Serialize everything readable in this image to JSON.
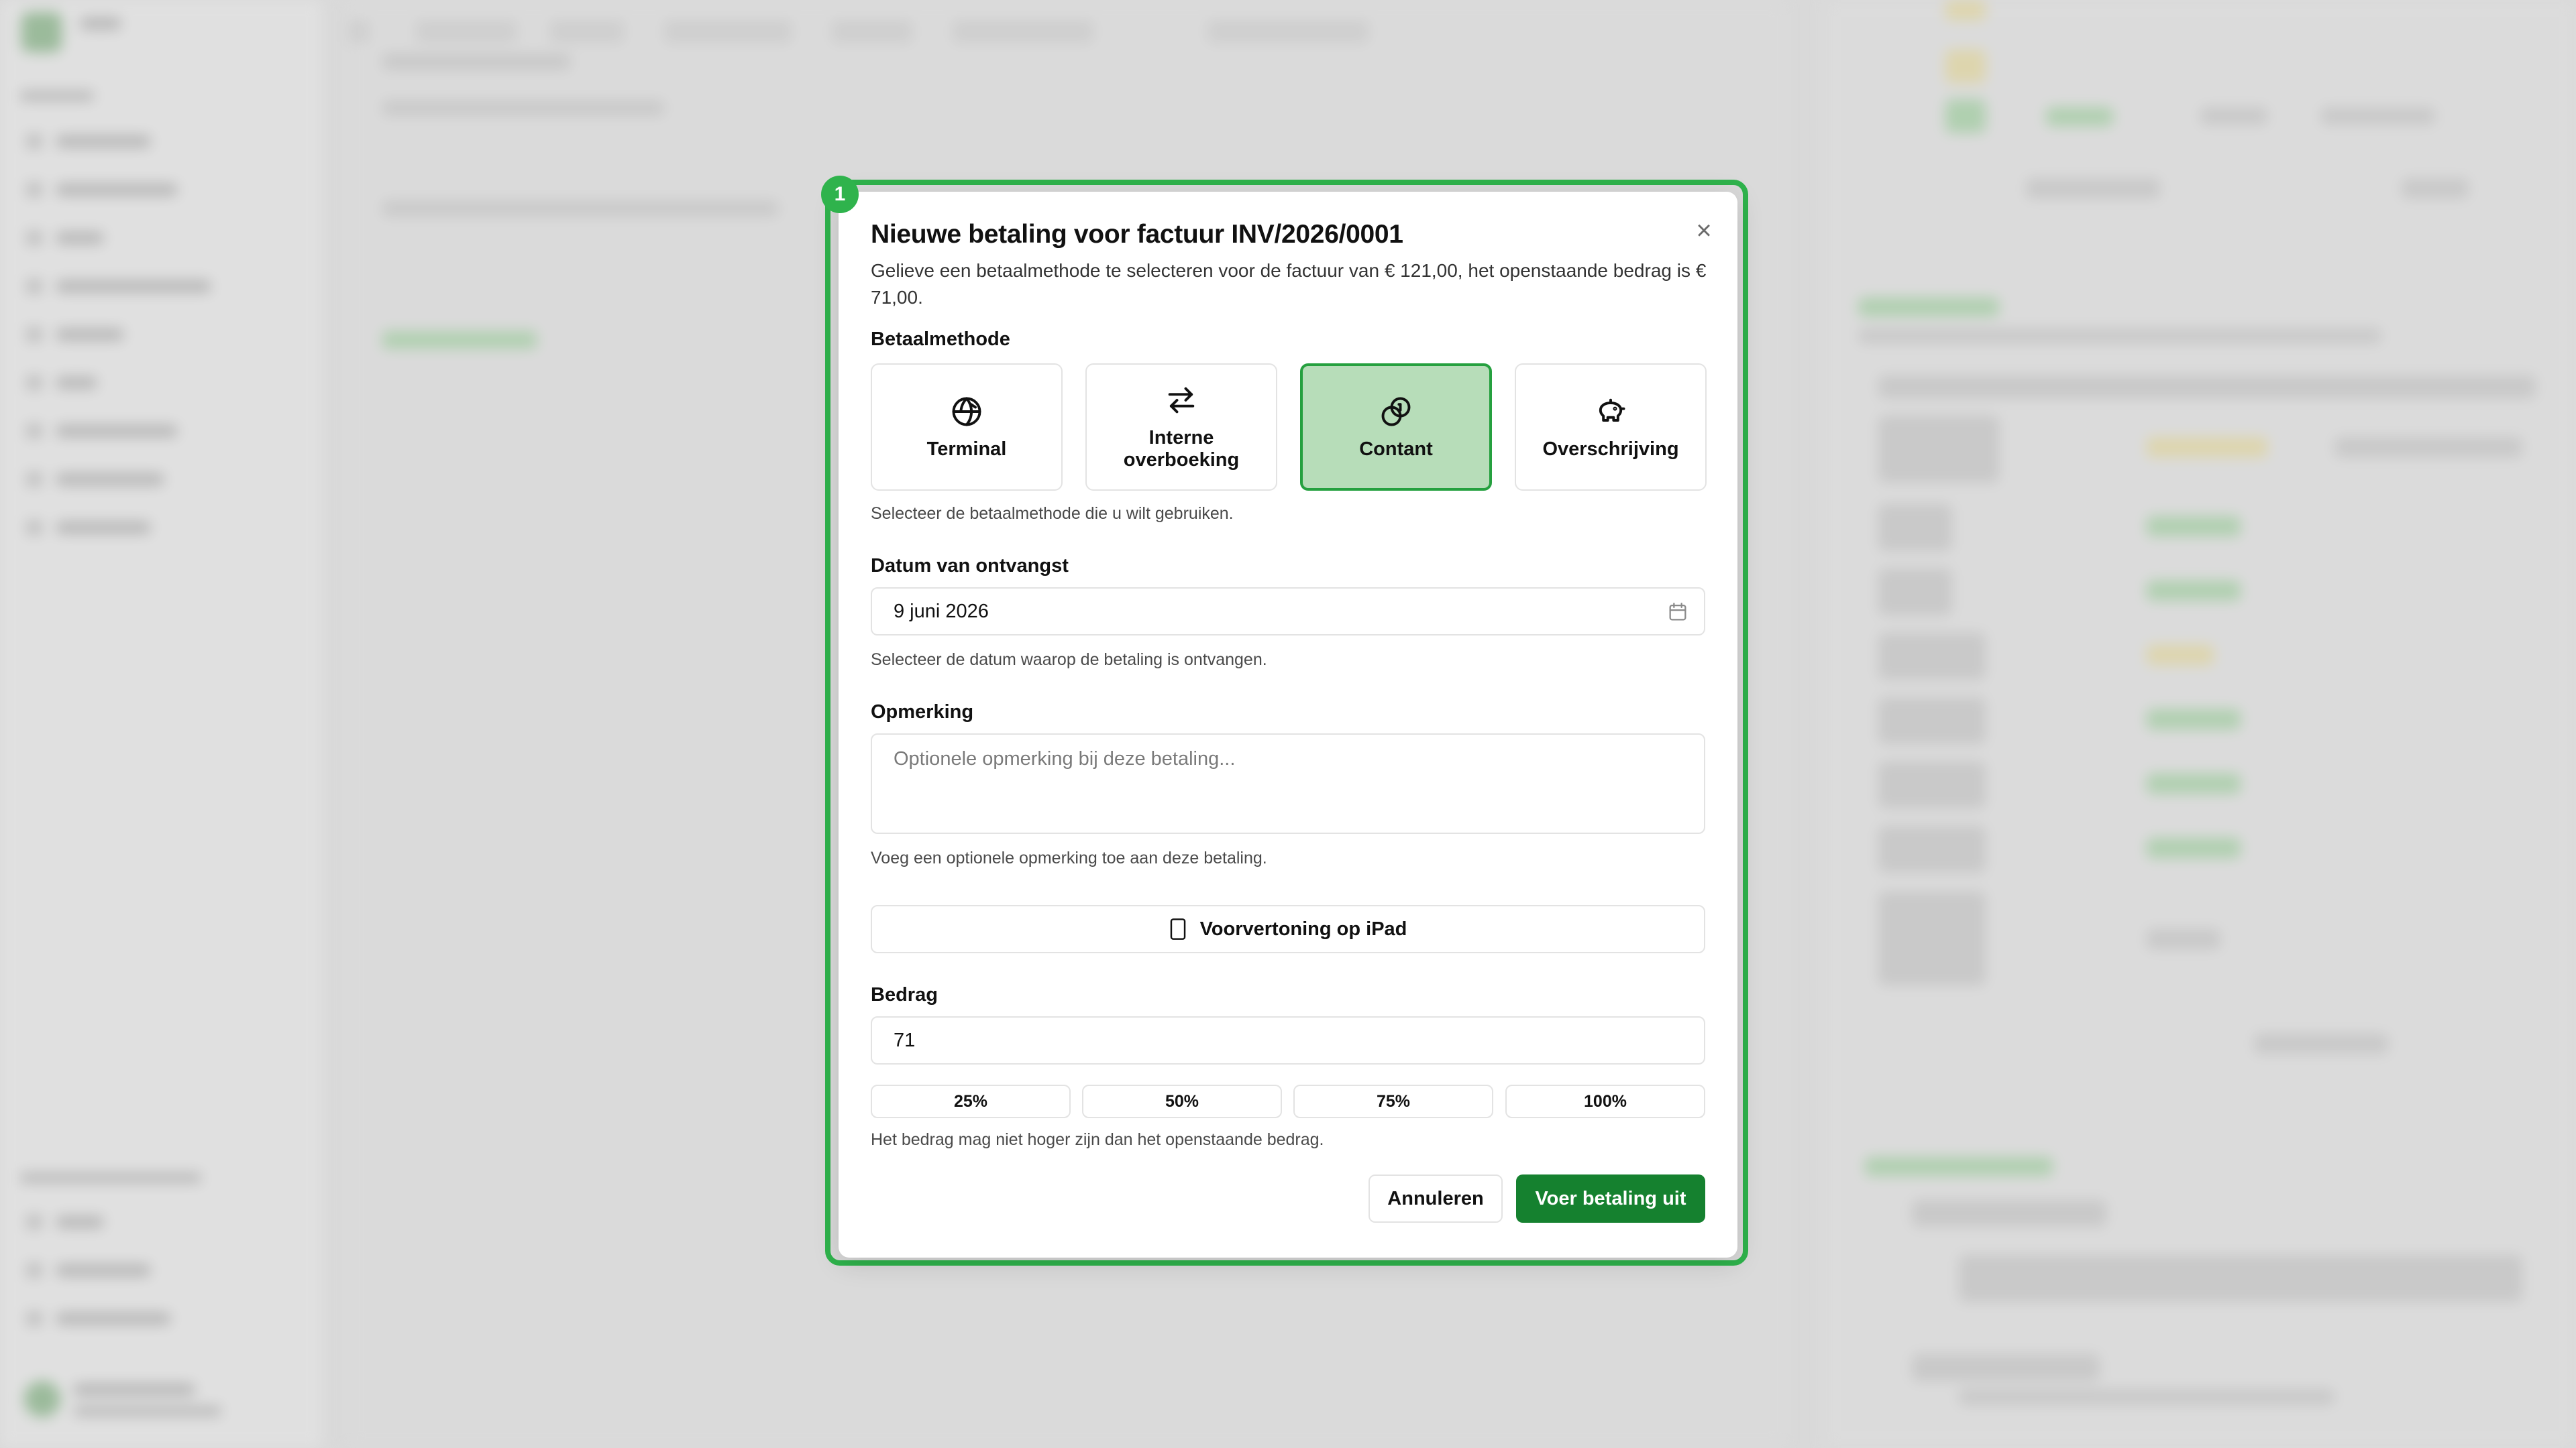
{
  "dialog": {
    "title": "Nieuwe betaling voor factuur INV/2026/0001",
    "description": "Gelieve een betaalmethode te selecteren voor de factuur van € 121,00, het openstaande bedrag is € 71,00.",
    "highlight_number": "1",
    "close_icon": "close-icon"
  },
  "payment_method": {
    "label": "Betaalmethode",
    "help": "Selecteer de betaalmethode die u wilt gebruiken.",
    "selected": "Contant",
    "options": [
      {
        "label": "Terminal",
        "icon": "globe-icon"
      },
      {
        "label": "Interne overboeking",
        "icon": "arrows-swap-icon"
      },
      {
        "label": "Contant",
        "icon": "coins-icon"
      },
      {
        "label": "Overschrijving",
        "icon": "piggy-bank-icon"
      }
    ]
  },
  "received_date": {
    "label": "Datum van ontvangst",
    "value": "9 juni 2026",
    "help": "Selecteer de datum waarop de betaling is ontvangen.",
    "icon": "calendar-icon"
  },
  "remark": {
    "label": "Opmerking",
    "placeholder": "Optionele opmerking bij deze betaling...",
    "help": "Voeg een optionele opmerking toe aan deze betaling."
  },
  "preview": {
    "label": "Voorvertoning op iPad",
    "icon": "tablet-icon"
  },
  "amount": {
    "label": "Bedrag",
    "value": "71",
    "presets": [
      "25%",
      "50%",
      "75%",
      "100%"
    ],
    "help": "Het bedrag mag niet hoger zijn dan het openstaande bedrag."
  },
  "actions": {
    "cancel": "Annuleren",
    "submit": "Voer betaling uit"
  },
  "colors": {
    "accent": "#2fb34c",
    "primary_button": "#15812f",
    "selected_bg": "#b7ddb9"
  }
}
